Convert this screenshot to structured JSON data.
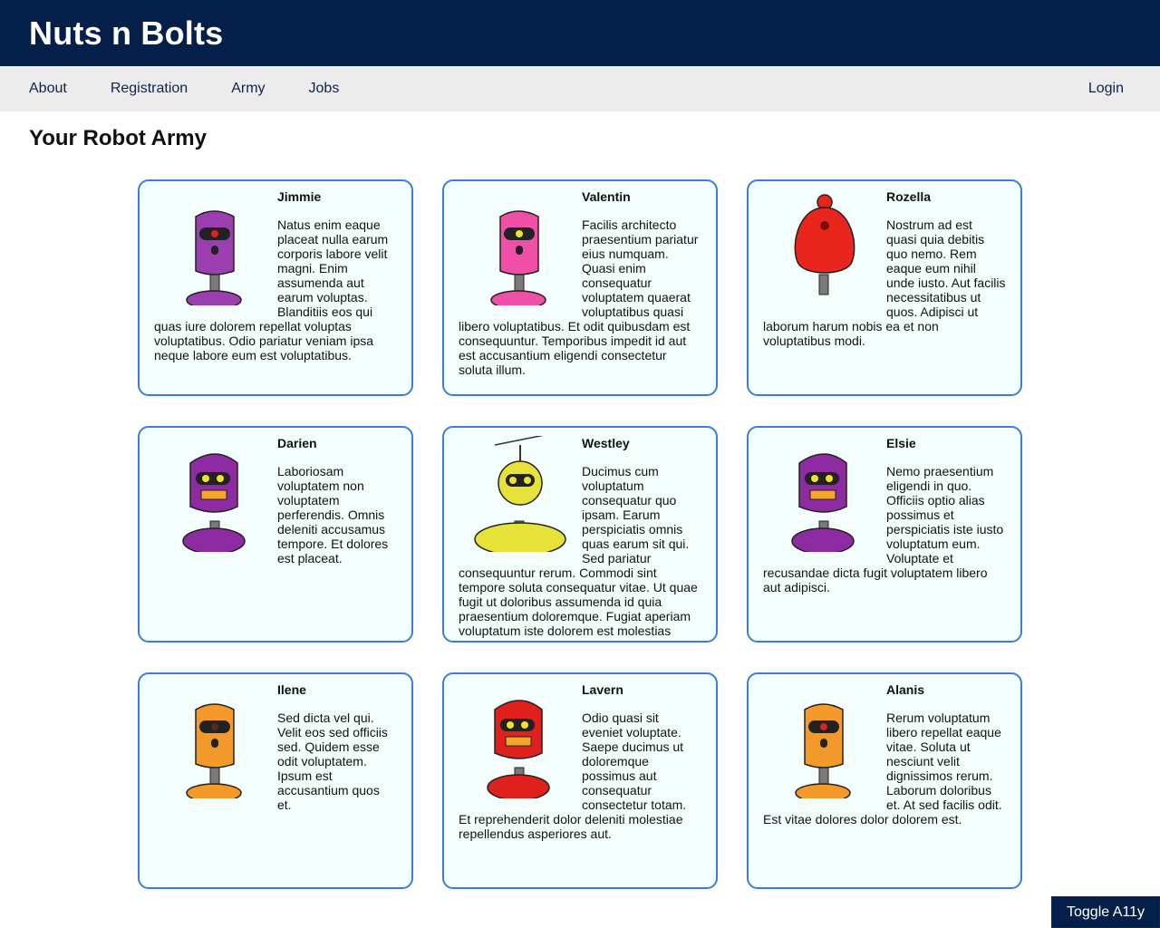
{
  "header": {
    "brand": "Nuts n Bolts"
  },
  "nav": {
    "items": [
      {
        "label": "About"
      },
      {
        "label": "Registration"
      },
      {
        "label": "Army"
      },
      {
        "label": "Jobs"
      }
    ],
    "login": "Login"
  },
  "page": {
    "title": "Your Robot Army"
  },
  "robots": [
    {
      "name": "Jimmie",
      "description": "Natus enim eaque placeat nulla earum corporis labore velit magni. Enim assumenda aut earum voluptas. Blanditiis eos qui quas iure dolorem repellat voluptas voluptatibus. Odio pariatur veniam ipsa neque labore eum est voluptatibus.",
      "color": "#9b3fb0",
      "shape": "tall",
      "eye": "#e02020"
    },
    {
      "name": "Valentin",
      "description": "Facilis architecto praesentium pariatur eius numquam. Quasi enim consequatur voluptatem quaerat voluptatibus quasi libero voluptatibus. Et odit quibusdam est consequuntur. Temporibus impedit id aut est accusantium eligendi consectetur soluta illum.",
      "color": "#ef4fa6",
      "shape": "tall",
      "eye": "#f4e12a"
    },
    {
      "name": "Rozella",
      "description": "Nostrum ad est quasi quia debitis quo nemo. Rem eaque eum nihil unde iusto. Aut facilis necessitatibus ut quos. Adipisci ut laborum harum nobis ea et non voluptatibus modi.",
      "color": "#e8261e",
      "shape": "drop",
      "eye": "#7a0f0a"
    },
    {
      "name": "Darien",
      "description": "Laboriosam voluptatem non voluptatem perferendis. Omnis deleniti accusamus tempore. Et dolores est placeat.",
      "color": "#8e2ba3",
      "shape": "wide",
      "eye": "#f4e12a"
    },
    {
      "name": "Westley",
      "description": "Ducimus cum voluptatum consequatur quo ipsam. Earum perspiciatis omnis quas earum sit qui. Sed pariatur consequuntur rerum. Commodi sint tempore soluta consequatur vitae. Ut quae fugit ut doloribus assumenda id quia praesentium doloremque. Fugiat aperiam voluptatum iste dolorem est molestias",
      "color": "#e6e23a",
      "shape": "round",
      "eye": "#333"
    },
    {
      "name": "Elsie",
      "description": "Nemo praesentium eligendi in quo. Officiis optio alias possimus et perspiciatis iste iusto voluptatum eum. Voluptate et recusandae dicta fugit voluptatem libero aut adipisci.",
      "color": "#8e2ba3",
      "shape": "wide",
      "eye": "#f4e12a"
    },
    {
      "name": "Ilene",
      "description": "Sed dicta vel qui. Velit eos sed officiis sed. Quidem esse odit voluptatem. Ipsum est accusantium quos et.",
      "color": "#f39a2a",
      "shape": "tall",
      "eye": "#5a2a10"
    },
    {
      "name": "Lavern",
      "description": "Odio quasi sit eveniet voluptate. Saepe ducimus ut doloremque possimus aut consequatur consectetur totam. Et reprehenderit dolor deleniti molestiae repellendus asperiores aut.",
      "color": "#e0201c",
      "shape": "wide",
      "eye": "#f4e12a"
    },
    {
      "name": "Alanis",
      "description": "Rerum voluptatum libero repellat eaque vitae. Soluta ut nesciunt velit dignissimos rerum. Laborum doloribus et. At sed facilis odit. Est vitae dolores dolor dolorem est.",
      "color": "#f39a2a",
      "shape": "tall",
      "eye": "#e02020"
    }
  ],
  "toggle": {
    "label": "Toggle A11y"
  }
}
